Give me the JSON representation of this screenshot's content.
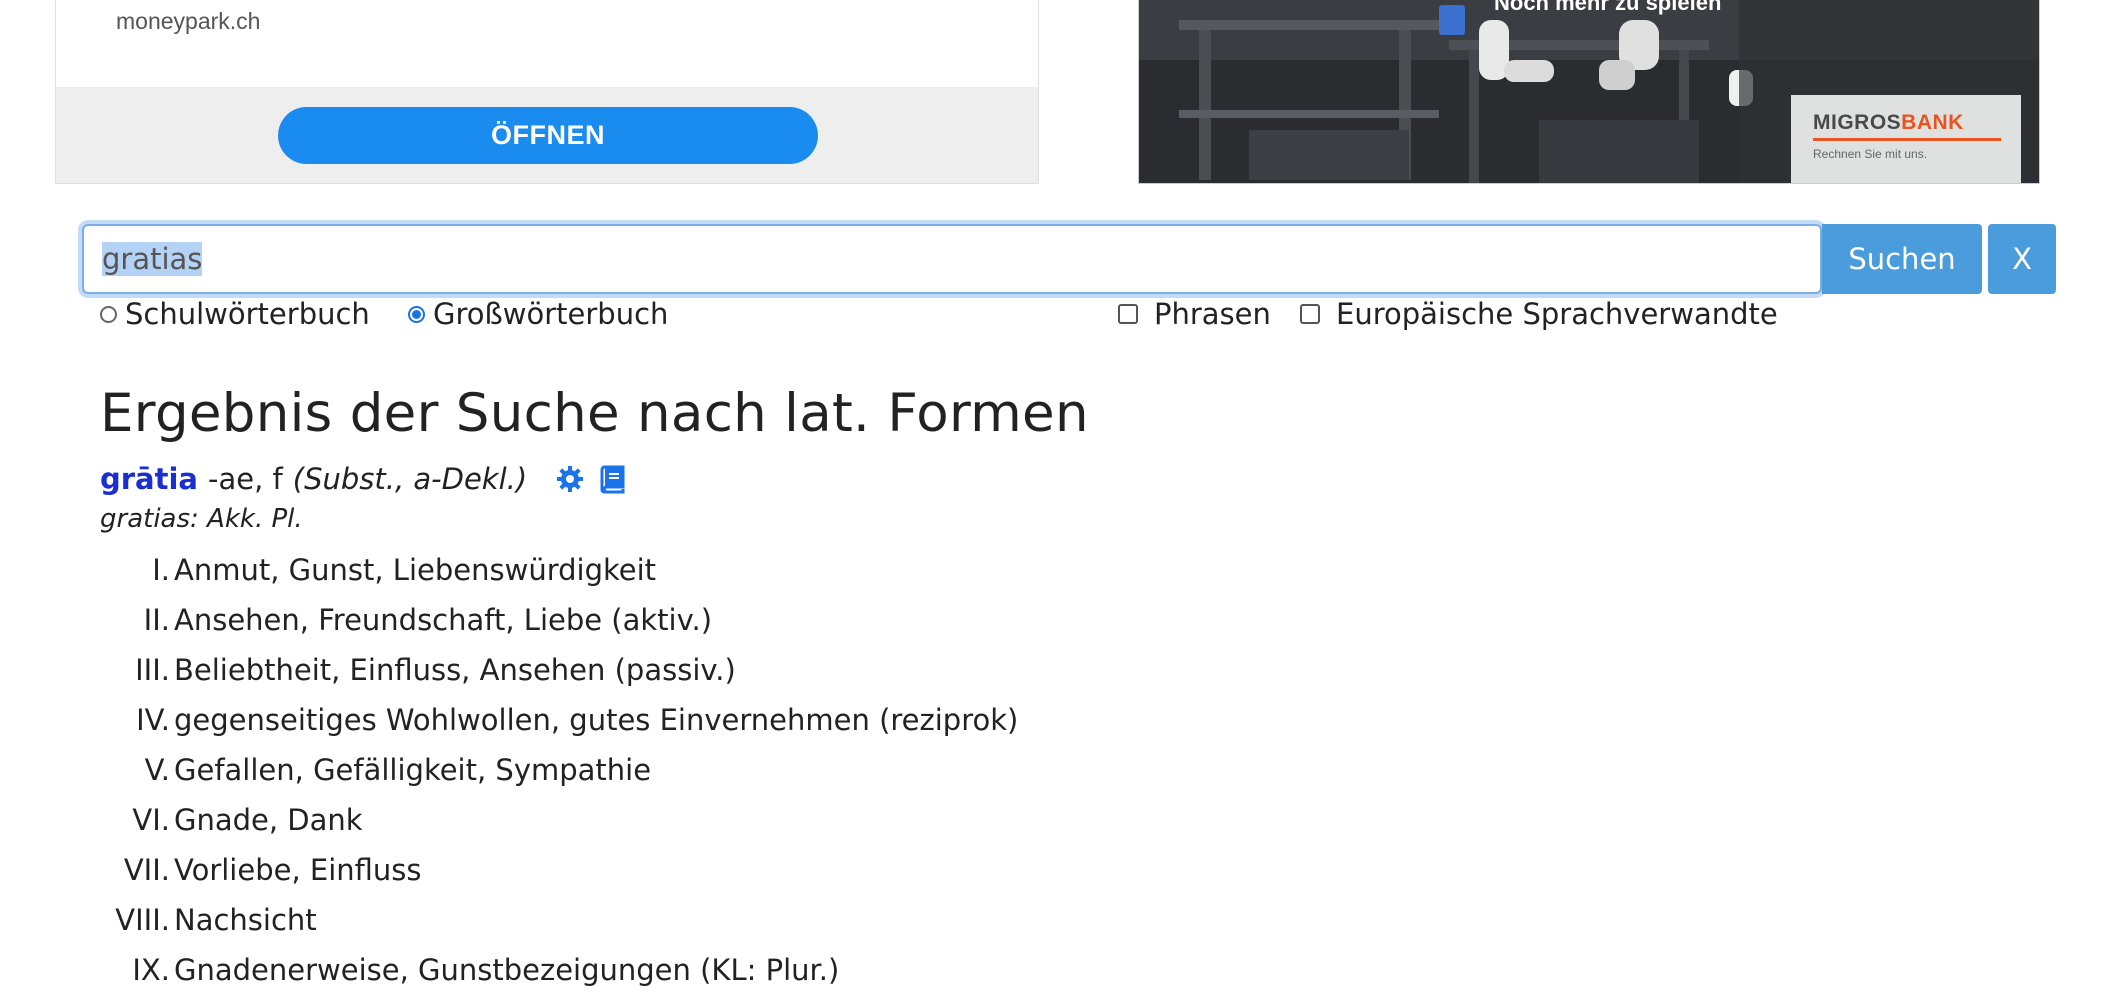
{
  "ads": {
    "left": {
      "domain": "moneypark.ch",
      "open_label": "ÖFFNEN"
    },
    "right": {
      "caption": "Noch mehr zu spielen",
      "brand_prefix": "MIGROS",
      "brand_suffix": "BANK",
      "slogan": "Rechnen Sie mit uns."
    }
  },
  "search": {
    "query": "gratias",
    "submit_label": "Suchen",
    "clear_label": "X",
    "dictionary_options": [
      {
        "label": "Schulwörterbuch",
        "selected": false
      },
      {
        "label": "Großwörterbuch",
        "selected": true
      }
    ],
    "filters": [
      {
        "label": "Phrasen",
        "checked": false
      },
      {
        "label": "Europäische Sprachverwandte",
        "checked": false
      }
    ]
  },
  "results": {
    "heading": "Ergebnis der Suche nach lat. Formen",
    "entry": {
      "lemma": "grātia",
      "grammar": "-ae, f",
      "word_class": "(Subst., a-Dekl.)",
      "icons": [
        "gear-icon",
        "book-icon"
      ],
      "form_info": "gratias: Akk. Pl.",
      "meanings": [
        {
          "num": "I.",
          "text": "Anmut, Gunst, Liebenswürdigkeit"
        },
        {
          "num": "II.",
          "text": "Ansehen, Freundschaft, Liebe (aktiv.)"
        },
        {
          "num": "III.",
          "text": "Beliebtheit, Einfluss, Ansehen (passiv.)"
        },
        {
          "num": "IV.",
          "text": "gegenseitiges Wohlwollen, gutes Einvernehmen (reziprok)"
        },
        {
          "num": "V.",
          "text": "Gefallen, Gefälligkeit, Sympathie"
        },
        {
          "num": "VI.",
          "text": "Gnade, Dank"
        },
        {
          "num": "VII.",
          "text": "Vorliebe, Einfluss"
        },
        {
          "num": "VIII.",
          "text": "Nachsicht"
        },
        {
          "num": "IX.",
          "text": "Gnadenerweise, Gunstbezeigungen (KL: Plur.)"
        }
      ]
    }
  },
  "colors": {
    "lemma": "#1a2fd0",
    "button": "#4a9cdc",
    "ad_button": "#1a8cf0",
    "icon": "#1a73e8"
  }
}
